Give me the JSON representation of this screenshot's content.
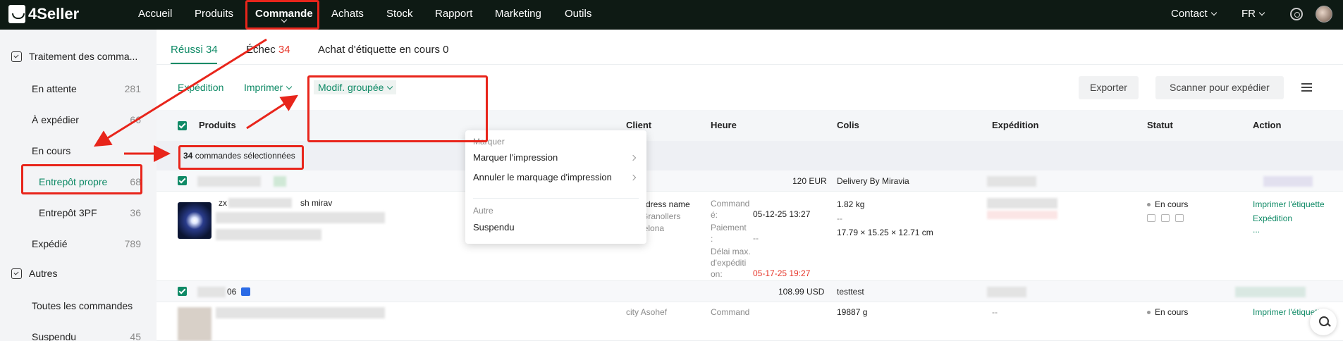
{
  "app": {
    "logo_text": "4Seller"
  },
  "topnav": {
    "items": [
      "Accueil",
      "Produits",
      "Commande",
      "Achats",
      "Stock",
      "Rapport",
      "Marketing",
      "Outils"
    ],
    "contact": "Contact",
    "language": "FR"
  },
  "sidebar": {
    "section1": "Traitement des comma...",
    "items": [
      {
        "label": "En attente",
        "count": "281"
      },
      {
        "label": "À expédier",
        "count": "66"
      },
      {
        "label": "En cours",
        "count": ""
      },
      {
        "label": "Entrepôt propre",
        "count": "68"
      },
      {
        "label": "Entrepôt 3PF",
        "count": "36"
      },
      {
        "label": "Expédié",
        "count": "789"
      }
    ],
    "section2": "Autres",
    "items2": [
      {
        "label": "Toutes les commandes",
        "count": ""
      },
      {
        "label": "Suspendu",
        "count": "45"
      }
    ]
  },
  "tabs": [
    {
      "label": "Réussi",
      "count": "34"
    },
    {
      "label": "Échec",
      "count": "34"
    },
    {
      "label": "Achat d'étiquette en cours",
      "count": "0"
    }
  ],
  "toolbar": {
    "expedition": "Expédition",
    "imprimer": "Imprimer",
    "modif": "Modif. groupée",
    "exporter": "Exporter",
    "scanner": "Scanner pour expédier"
  },
  "table": {
    "headers": [
      "Produits",
      "Client",
      "Heure",
      "Colis",
      "Expédition",
      "Statut",
      "Action"
    ]
  },
  "selection": {
    "count": "34",
    "text": " commandes sélectionnées"
  },
  "dropdown": {
    "header1": "Marquer",
    "item1": "Marquer l'impression",
    "item2": "Annuler le marquage d'impression",
    "header2": "Autre",
    "item3": "Suspendu"
  },
  "group1": {
    "amount": "120 EUR",
    "shipping": "Delivery By Miravia"
  },
  "order1": {
    "product_partial": "zx",
    "product_partial2": "sh mirav",
    "client_name": "zxz adress name",
    "city": "Granollers",
    "region": "Barcelona",
    "ordered_label": "Command\né:",
    "ordered_value": "05-12-25 13:27",
    "paid_label": "Paiement\n:",
    "paid_value": "--",
    "deadline_label": "Délai max.\nd'expéditi\non:",
    "deadline_value": "05-17-25 19:27",
    "weight": "1.82 kg",
    "dash": "--",
    "dims": "17.79 × 15.25 × 12.71 cm",
    "status": "En cours",
    "action1": "Imprimer l'étiquette",
    "action2": "Expédition",
    "action3": "..."
  },
  "group2": {
    "id_partial": "06",
    "amount": "108.99 USD",
    "shipping": "testtest"
  },
  "order2": {
    "client_partial": "city Asohef",
    "ordered_label": "Command",
    "weight": "19887 g",
    "dash": "--",
    "status": "En cours",
    "action1": "Imprimer l'étiquette"
  },
  "colors": {
    "accent": "#0f8a66",
    "danger": "#e6362a",
    "topbar": "#0e1a14",
    "annotation": "#e8251b"
  },
  "icons": [
    "gear-icon",
    "avatar",
    "checkbox-icon",
    "printer-icon",
    "search-icon",
    "list-settings-icon",
    "flag-es-icon"
  ]
}
